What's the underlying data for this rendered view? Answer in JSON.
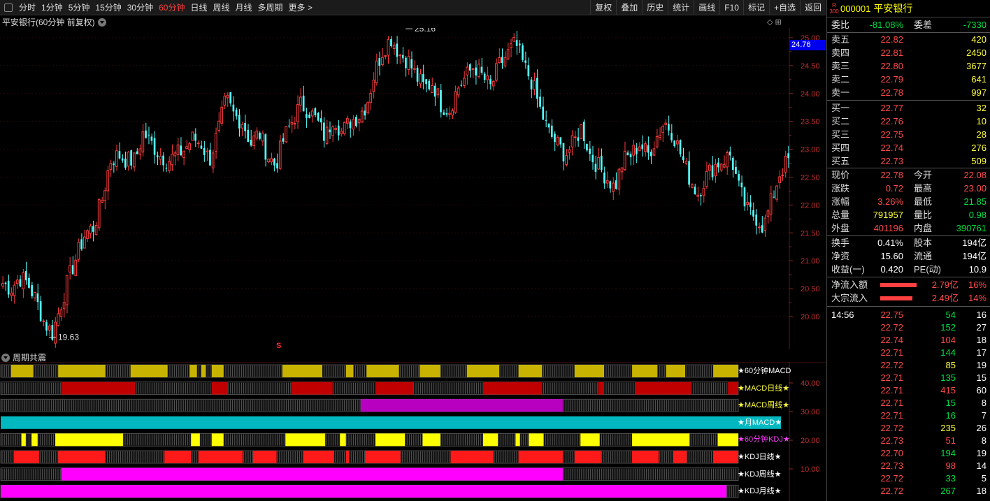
{
  "toolbar": {
    "periods": [
      "分时",
      "1分钟",
      "5分钟",
      "15分钟",
      "30分钟",
      "60分钟",
      "日线",
      "周线",
      "月线",
      "多周期",
      "更多 >"
    ],
    "active_period": "60分钟",
    "buttons": [
      "复权",
      "叠加",
      "历史",
      "统计",
      "画线",
      "F10",
      "标记",
      "+自选",
      "返回"
    ]
  },
  "chart": {
    "title": "平安银行(60分钟 前复权)",
    "icons": "◇ ⊞",
    "current_price_tag": "24.76",
    "high_label": "25.16",
    "low_label": "19.63",
    "signal_mark": "S",
    "y_ticks": [
      "25.00",
      "24.50",
      "24.00",
      "23.50",
      "23.00",
      "22.50",
      "22.00",
      "21.50",
      "21.00",
      "20.50",
      "20.00"
    ],
    "colors": {
      "up": "#ff3c3c",
      "down": "#54ffff",
      "bg": "#000000"
    }
  },
  "chart_data": {
    "type": "candlestick",
    "title": "平安银行(60分钟 前复权)",
    "ylim": [
      19.5,
      25.3
    ],
    "high": 25.16,
    "low": 19.63,
    "approx_close_path": [
      20.6,
      20.5,
      20.7,
      20.6,
      20.3,
      19.9,
      19.7,
      20.2,
      20.7,
      21.1,
      21.5,
      21.6,
      22.1,
      22.8,
      22.9,
      22.8,
      22.8,
      23.3,
      23.1,
      22.9,
      22.8,
      22.9,
      23.0,
      23.2,
      23.1,
      22.8,
      23.3,
      23.9,
      23.6,
      23.5,
      23.1,
      23.3,
      22.9,
      22.7,
      23.2,
      23.5,
      23.8,
      23.7,
      23.5,
      23.2,
      23.6,
      23.3,
      23.5,
      23.6,
      23.8,
      24.4,
      24.8,
      25.0,
      24.7,
      24.6,
      24.3,
      24.1,
      24.2,
      23.8,
      23.7,
      24.1,
      24.3,
      24.5,
      24.3,
      24.1,
      24.5,
      24.7,
      24.9,
      24.5,
      24.2,
      23.7,
      23.3,
      23.1,
      22.9,
      23.1,
      23.4,
      22.9,
      22.7,
      22.5,
      22.3,
      22.8,
      22.9,
      23.1,
      22.9,
      23.2,
      23.5,
      23.3,
      22.9,
      22.5,
      22.2,
      22.5,
      22.7,
      22.8,
      22.9,
      22.3,
      21.9,
      21.8,
      21.6,
      22.1,
      22.6,
      22.8
    ]
  },
  "indicator": {
    "title": "周期共震",
    "y_ticks": [
      "40.00",
      "30.00",
      "20.00",
      "10.00"
    ],
    "rows": [
      {
        "label": "★60分钟MACD",
        "label_color": "#ffffff",
        "color": "#c8b400",
        "mode": "segments"
      },
      {
        "label": "★MACD日线★",
        "label_color": "#ffff40",
        "color": "#c00000",
        "mode": "segments"
      },
      {
        "label": "★MACD周线★",
        "label_color": "#ffff40",
        "color": "#b800c0",
        "mode": "segments"
      },
      {
        "label": "★月MACD★",
        "label_color": "#ffffff",
        "color": "#00b8c0",
        "mode": "full"
      },
      {
        "label": "★60分钟KDJ★",
        "label_color": "#ff40ff",
        "color": "#ffff00",
        "mode": "segments"
      },
      {
        "label": "★KDJ日线★",
        "label_color": "#ffffff",
        "color": "#ff1a1a",
        "mode": "segments"
      },
      {
        "label": "★KDJ周线★",
        "label_color": "#ffffff",
        "color": "#ff00ff",
        "mode": "segments"
      },
      {
        "label": "★KDJ月线★",
        "label_color": "#ffffff",
        "color": "#ff00ff",
        "mode": "segments"
      }
    ]
  },
  "quote": {
    "r300": "R\n300",
    "code": "000001",
    "name": "平安银行",
    "weibi_label": "委比",
    "weibi": "-81.08%",
    "weicha_label": "委差",
    "weicha": "-7330",
    "asks": [
      {
        "label": "卖五",
        "price": "22.82",
        "vol": "420"
      },
      {
        "label": "卖四",
        "price": "22.81",
        "vol": "2450"
      },
      {
        "label": "卖三",
        "price": "22.80",
        "vol": "3677"
      },
      {
        "label": "卖二",
        "price": "22.79",
        "vol": "641"
      },
      {
        "label": "卖一",
        "price": "22.78",
        "vol": "997"
      }
    ],
    "bids": [
      {
        "label": "买一",
        "price": "22.77",
        "vol": "32"
      },
      {
        "label": "买二",
        "price": "22.76",
        "vol": "10"
      },
      {
        "label": "买三",
        "price": "22.75",
        "vol": "28"
      },
      {
        "label": "买四",
        "price": "22.74",
        "vol": "276"
      },
      {
        "label": "买五",
        "price": "22.73",
        "vol": "509"
      }
    ],
    "stats": [
      {
        "l1": "现价",
        "v1": "22.78",
        "c1": "red",
        "l2": "今开",
        "v2": "22.08",
        "c2": "red"
      },
      {
        "l1": "涨跌",
        "v1": "0.72",
        "c1": "red",
        "l2": "最高",
        "v2": "23.00",
        "c2": "red"
      },
      {
        "l1": "涨幅",
        "v1": "3.26%",
        "c1": "red",
        "l2": "最低",
        "v2": "21.85",
        "c2": "green"
      },
      {
        "l1": "总量",
        "v1": "791957",
        "c1": "yellow",
        "l2": "量比",
        "v2": "0.98",
        "c2": "green"
      },
      {
        "l1": "外盘",
        "v1": "401196",
        "c1": "red",
        "l2": "内盘",
        "v2": "390761",
        "c2": "green"
      }
    ],
    "stats2": [
      {
        "l1": "换手",
        "v1": "0.41%",
        "l2": "股本",
        "v2": "194亿"
      },
      {
        "l1": "净资",
        "v1": "15.60",
        "l2": "流通",
        "v2": "194亿"
      },
      {
        "l1": "收益(一)",
        "v1": "0.420",
        "l2": "PE(动)",
        "v2": "10.9"
      }
    ],
    "flows": [
      {
        "label": "净流入额",
        "value": "2.79亿",
        "pct": "16%",
        "bar": 0.9
      },
      {
        "label": "大宗流入",
        "value": "2.49亿",
        "pct": "14%",
        "bar": 0.8
      }
    ],
    "ticks": [
      {
        "time": "14:56",
        "price": "22.75",
        "pc": "red",
        "vol": "54",
        "vc": "green",
        "n": "16"
      },
      {
        "time": "",
        "price": "22.72",
        "pc": "red",
        "vol": "152",
        "vc": "green",
        "n": "27"
      },
      {
        "time": "",
        "price": "22.74",
        "pc": "red",
        "vol": "104",
        "vc": "red",
        "n": "18"
      },
      {
        "time": "",
        "price": "22.71",
        "pc": "red",
        "vol": "144",
        "vc": "green",
        "n": "17"
      },
      {
        "time": "",
        "price": "22.72",
        "pc": "red",
        "vol": "85",
        "vc": "yellow",
        "n": "19"
      },
      {
        "time": "",
        "price": "22.71",
        "pc": "red",
        "vol": "135",
        "vc": "green",
        "n": "15"
      },
      {
        "time": "",
        "price": "22.71",
        "pc": "red",
        "vol": "415",
        "vc": "red",
        "n": "60"
      },
      {
        "time": "",
        "price": "22.71",
        "pc": "red",
        "vol": "15",
        "vc": "green",
        "n": "8"
      },
      {
        "time": "",
        "price": "22.71",
        "pc": "red",
        "vol": "16",
        "vc": "green",
        "n": "7"
      },
      {
        "time": "",
        "price": "22.72",
        "pc": "red",
        "vol": "235",
        "vc": "yellow",
        "n": "26"
      },
      {
        "time": "",
        "price": "22.73",
        "pc": "red",
        "vol": "51",
        "vc": "red",
        "n": "8"
      },
      {
        "time": "",
        "price": "22.70",
        "pc": "red",
        "vol": "194",
        "vc": "green",
        "n": "19"
      },
      {
        "time": "",
        "price": "22.73",
        "pc": "red",
        "vol": "98",
        "vc": "red",
        "n": "14"
      },
      {
        "time": "",
        "price": "22.72",
        "pc": "red",
        "vol": "33",
        "vc": "green",
        "n": "5"
      },
      {
        "time": "",
        "price": "22.72",
        "pc": "red",
        "vol": "267",
        "vc": "green",
        "n": "18"
      }
    ]
  }
}
